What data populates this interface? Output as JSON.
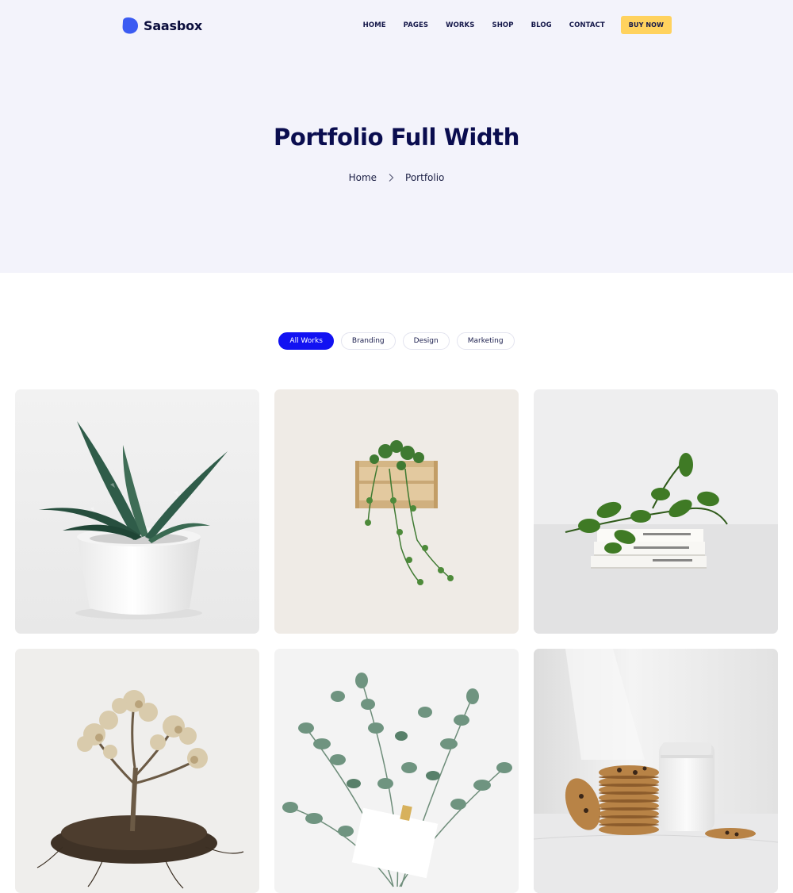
{
  "brand": {
    "name": "Saasbox",
    "color": "#3b5bf2"
  },
  "nav": {
    "items": [
      "HOME",
      "PAGES",
      "WORKS",
      "SHOP",
      "BLOG",
      "CONTACT"
    ],
    "cta": "BUY NOW"
  },
  "hero": {
    "title": "Portfolio Full Width",
    "breadcrumb": [
      "Home",
      "Portfolio"
    ]
  },
  "filters": {
    "items": [
      "All Works",
      "Branding",
      "Design",
      "Marketing"
    ],
    "active": "All Works",
    "active_color": "#1212f2"
  },
  "portfolio": {
    "items": [
      {
        "image": "succulent-in-white-pot"
      },
      {
        "image": "ivy-in-wooden-crate"
      },
      {
        "image": "branch-on-books"
      },
      {
        "image": "uprooted-tree-with-soil"
      },
      {
        "image": "eucalyptus-bouquet-with-card"
      },
      {
        "image": "cookies-and-milk-jar"
      }
    ]
  }
}
